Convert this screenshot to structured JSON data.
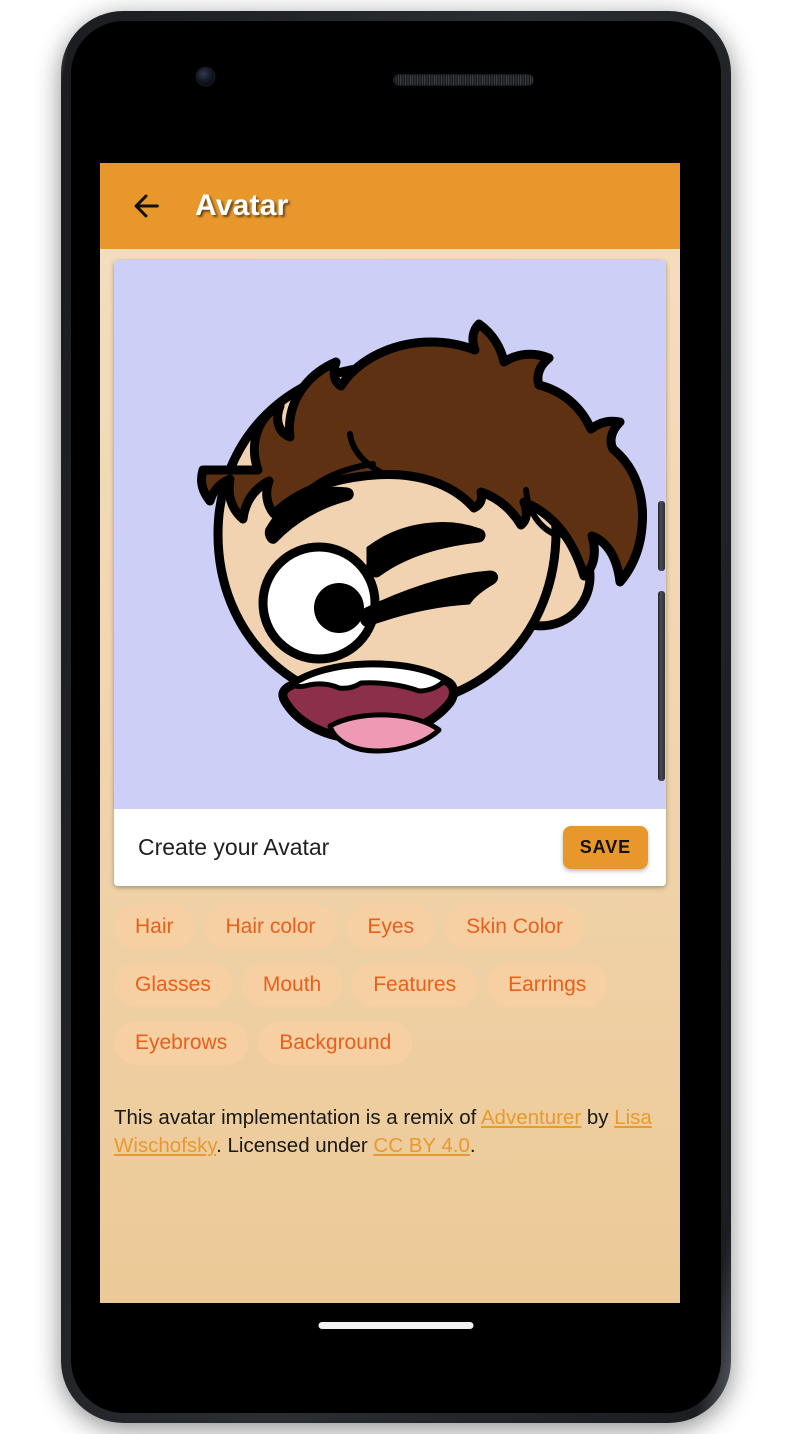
{
  "app": {
    "bar": {
      "back_icon": "arrow-left-icon",
      "title": "Avatar"
    }
  },
  "card": {
    "title": "Create your Avatar",
    "save_label": "SAVE",
    "avatar": {
      "background_color": "#cdcff6",
      "skin_color": "#f2d3b1",
      "hair_color": "#5e3113",
      "outline_color": "#000000",
      "eye_white_color": "#ffffff",
      "pupil_color": "#000000",
      "mouth_interior_color": "#8c2f4a",
      "tongue_color": "#ef9ab4",
      "teeth_color": "#ffffff",
      "expression": "winking-smile"
    }
  },
  "chips": [
    {
      "label": "Hair"
    },
    {
      "label": "Hair color"
    },
    {
      "label": "Eyes"
    },
    {
      "label": "Skin Color"
    },
    {
      "label": "Glasses"
    },
    {
      "label": "Mouth"
    },
    {
      "label": "Features"
    },
    {
      "label": "Earrings"
    },
    {
      "label": "Eyebrows"
    },
    {
      "label": "Background"
    }
  ],
  "attribution": {
    "part1": "This avatar implementation is a remix of ",
    "link1": "Adventurer",
    "part2": " by ",
    "link2": "Lisa Wischofsky",
    "part3": ". Licensed under ",
    "link3": "CC BY 4.0",
    "part4": "."
  },
  "theme": {
    "accent": "#e8972a",
    "chip_bg": "#f6cfa2",
    "chip_text": "#e8601c",
    "link": "#e89a2e",
    "page_bg_top": "#f4ddbd",
    "page_bg_bottom": "#ecc997"
  }
}
